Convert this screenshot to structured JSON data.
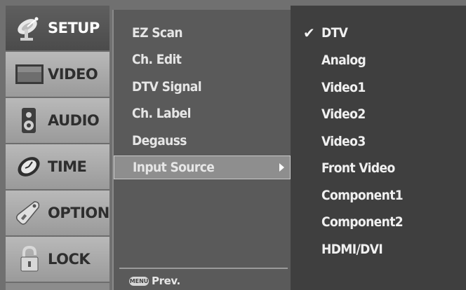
{
  "sidebar": {
    "items": [
      {
        "label": "SETUP",
        "icon": "satellite-icon",
        "active": true
      },
      {
        "label": "VIDEO",
        "icon": "tv-icon",
        "active": false
      },
      {
        "label": "AUDIO",
        "icon": "speaker-icon",
        "active": false
      },
      {
        "label": "TIME",
        "icon": "clock-icon",
        "active": false
      },
      {
        "label": "OPTION",
        "icon": "tag-icon",
        "active": false
      },
      {
        "label": "LOCK",
        "icon": "padlock-icon",
        "active": false
      }
    ]
  },
  "setup_menu": {
    "items": [
      {
        "label": "EZ Scan"
      },
      {
        "label": "Ch. Edit"
      },
      {
        "label": "DTV Signal"
      },
      {
        "label": "Ch. Label"
      },
      {
        "label": "Degauss"
      },
      {
        "label": "Input Source",
        "selected": true
      }
    ],
    "prev_key": "MENU",
    "prev_label": "Prev."
  },
  "input_source": {
    "options": [
      {
        "label": "DTV",
        "checked": true
      },
      {
        "label": "Analog"
      },
      {
        "label": "Video1"
      },
      {
        "label": "Video2"
      },
      {
        "label": "Video3"
      },
      {
        "label": "Front Video"
      },
      {
        "label": "Component1"
      },
      {
        "label": "Component2"
      },
      {
        "label": "HDMI/DVI"
      }
    ]
  },
  "colors": {
    "active_tab": "#555555",
    "menu_bg": "#5a5a5a",
    "submenu_bg": "#3f3f3f",
    "highlight": "#8e8e8e",
    "text": "#f0f0f0"
  }
}
